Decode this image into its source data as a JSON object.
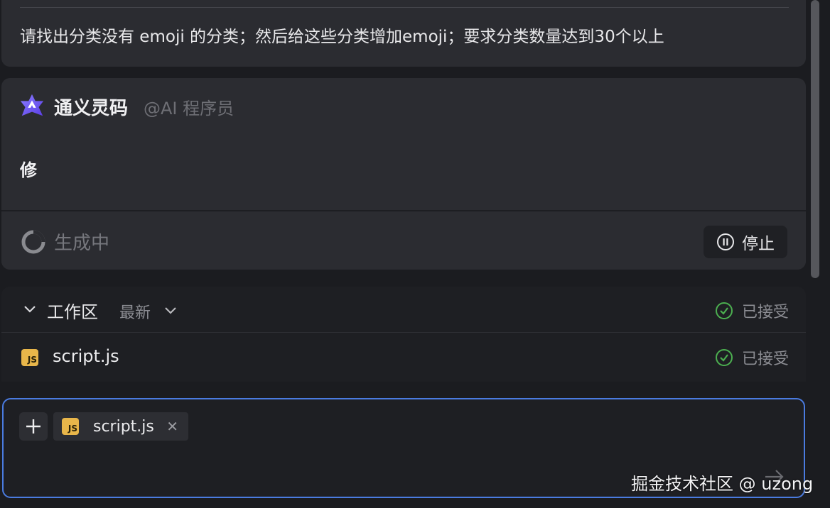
{
  "user_message": {
    "text": "请找出分类没有 emoji 的分类；然后给这些分类增加emoji；要求分类数量达到30个以上"
  },
  "assistant": {
    "name": "通义灵码",
    "role": "@AI 程序员",
    "partial_reply": "修",
    "status_text": "生成中",
    "stop_label": "停止",
    "logo_icon": "tongyi-lingma-logo",
    "accent_color": "#6f5cf2"
  },
  "workspace": {
    "title": "工作区",
    "version_label": "最新",
    "status_label": "已接受",
    "files": [
      {
        "name": "script.js",
        "type_badge": "JS",
        "status": "已接受"
      }
    ],
    "accepted_color": "#4caf50"
  },
  "input": {
    "context_file": {
      "name": "script.js",
      "type_badge": "JS"
    },
    "add_icon": "plus-icon",
    "send_icon": "send-arrow-icon",
    "border_color": "#4a7be0"
  },
  "watermark": "掘金技术社区 @ uzong"
}
